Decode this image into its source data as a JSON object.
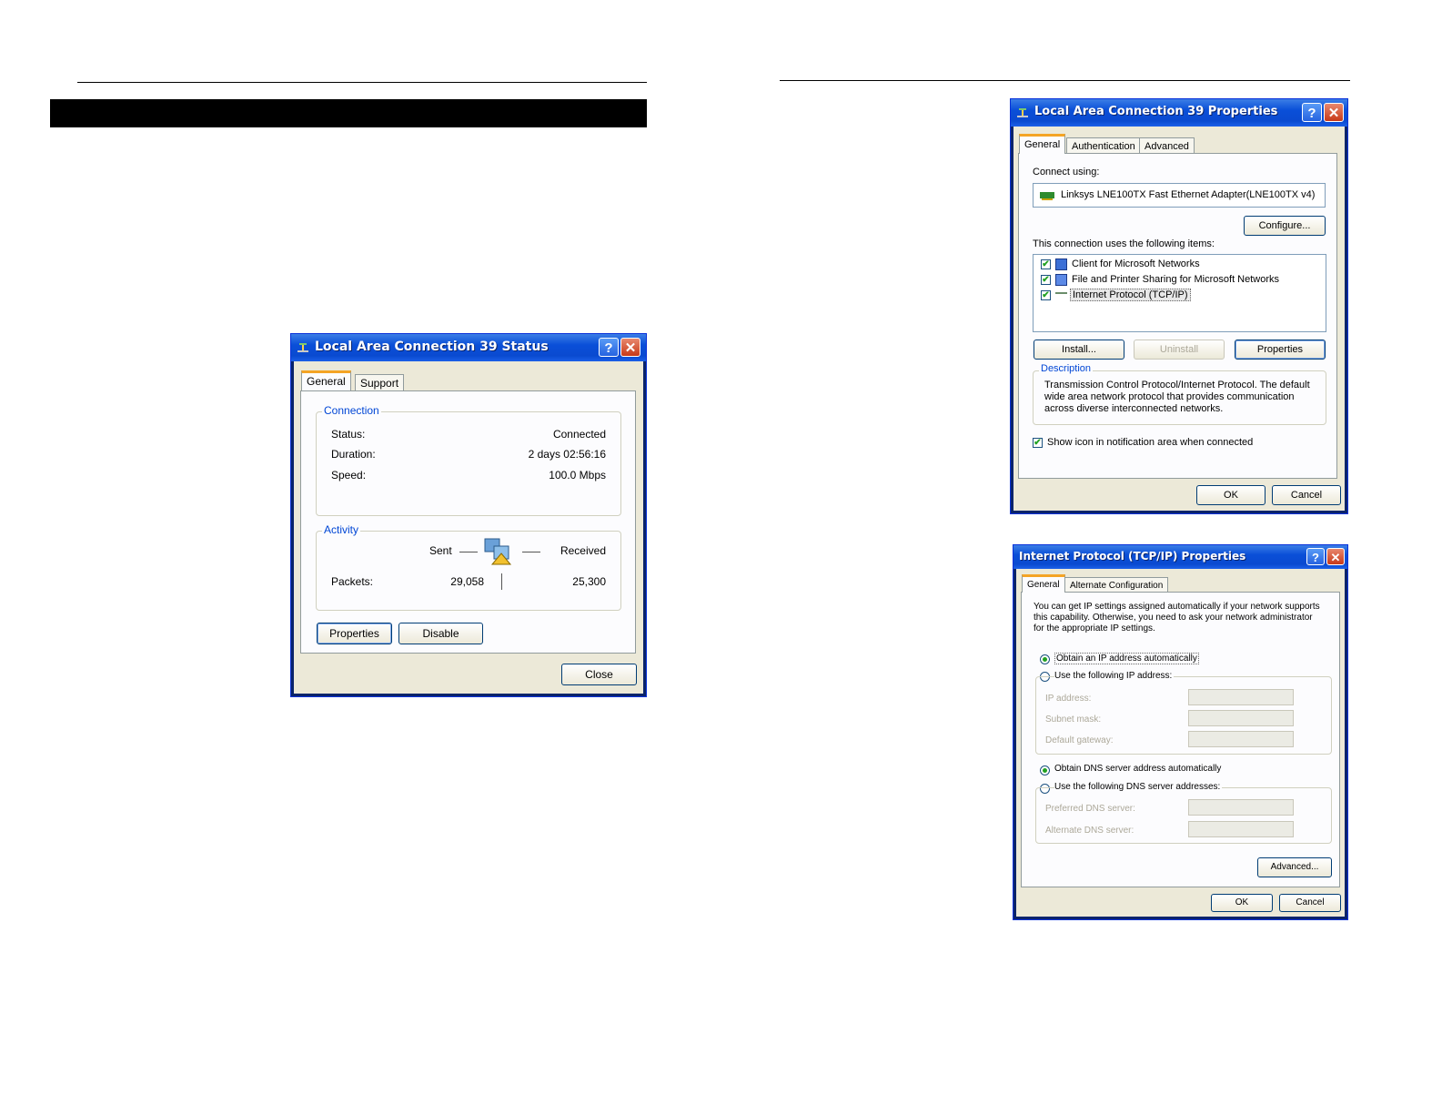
{
  "status_dialog": {
    "title": "Local Area Connection 39 Status",
    "tabs": [
      "General",
      "Support"
    ],
    "connection": {
      "legend": "Connection",
      "rows": [
        {
          "label": "Status:",
          "value": "Connected"
        },
        {
          "label": "Duration:",
          "value": "2 days 02:56:16"
        },
        {
          "label": "Speed:",
          "value": "100.0 Mbps"
        }
      ]
    },
    "activity": {
      "legend": "Activity",
      "sent_label": "Sent",
      "received_label": "Received",
      "packets_label": "Packets:",
      "packets_sent": "29,058",
      "packets_received": "25,300"
    },
    "buttons": {
      "properties": "Properties",
      "disable": "Disable",
      "close": "Close"
    }
  },
  "lan_properties_dialog": {
    "title": "Local Area Connection 39 Properties",
    "tabs": [
      "General",
      "Authentication",
      "Advanced"
    ],
    "connect_using_label": "Connect using:",
    "adapter": "Linksys LNE100TX Fast Ethernet Adapter(LNE100TX v4)",
    "configure_button": "Configure...",
    "items_label": "This connection uses the following items:",
    "items": [
      {
        "label": "Client for Microsoft Networks",
        "checked": true,
        "icon": "network-client-icon"
      },
      {
        "label": "File and Printer Sharing for Microsoft Networks",
        "checked": true,
        "icon": "file-sharing-icon"
      },
      {
        "label": "Internet Protocol (TCP/IP)",
        "checked": true,
        "icon": "protocol-icon"
      }
    ],
    "buttons": {
      "install": "Install...",
      "uninstall": "Uninstall",
      "properties": "Properties",
      "ok": "OK",
      "cancel": "Cancel"
    },
    "description_legend": "Description",
    "description": "Transmission Control Protocol/Internet Protocol. The default wide area network protocol that provides communication across diverse interconnected networks.",
    "show_icon_label": "Show icon in notification area when connected"
  },
  "tcpip_dialog": {
    "title": "Internet Protocol (TCP/IP) Properties",
    "tabs": [
      "General",
      "Alternate Configuration"
    ],
    "intro": "You can get IP settings assigned automatically if your network supports this capability. Otherwise, you need to ask your network administrator for the appropriate IP settings.",
    "obtain_ip_auto": "Obtain an IP address automatically",
    "use_following_ip": "Use the following IP address:",
    "ip_address_label": "IP address:",
    "subnet_mask_label": "Subnet mask:",
    "default_gateway_label": "Default gateway:",
    "obtain_dns_auto": "Obtain DNS server address automatically",
    "use_following_dns": "Use the following DNS server addresses:",
    "preferred_dns_label": "Preferred DNS server:",
    "alternate_dns_label": "Alternate DNS server:",
    "buttons": {
      "advanced": "Advanced...",
      "ok": "OK",
      "cancel": "Cancel"
    }
  },
  "colors": {
    "title_bar": "#0a4fd8",
    "dialog_face": "#ece9d8",
    "legend_text": "#0046d5",
    "tab_accent": "#f4a425"
  }
}
